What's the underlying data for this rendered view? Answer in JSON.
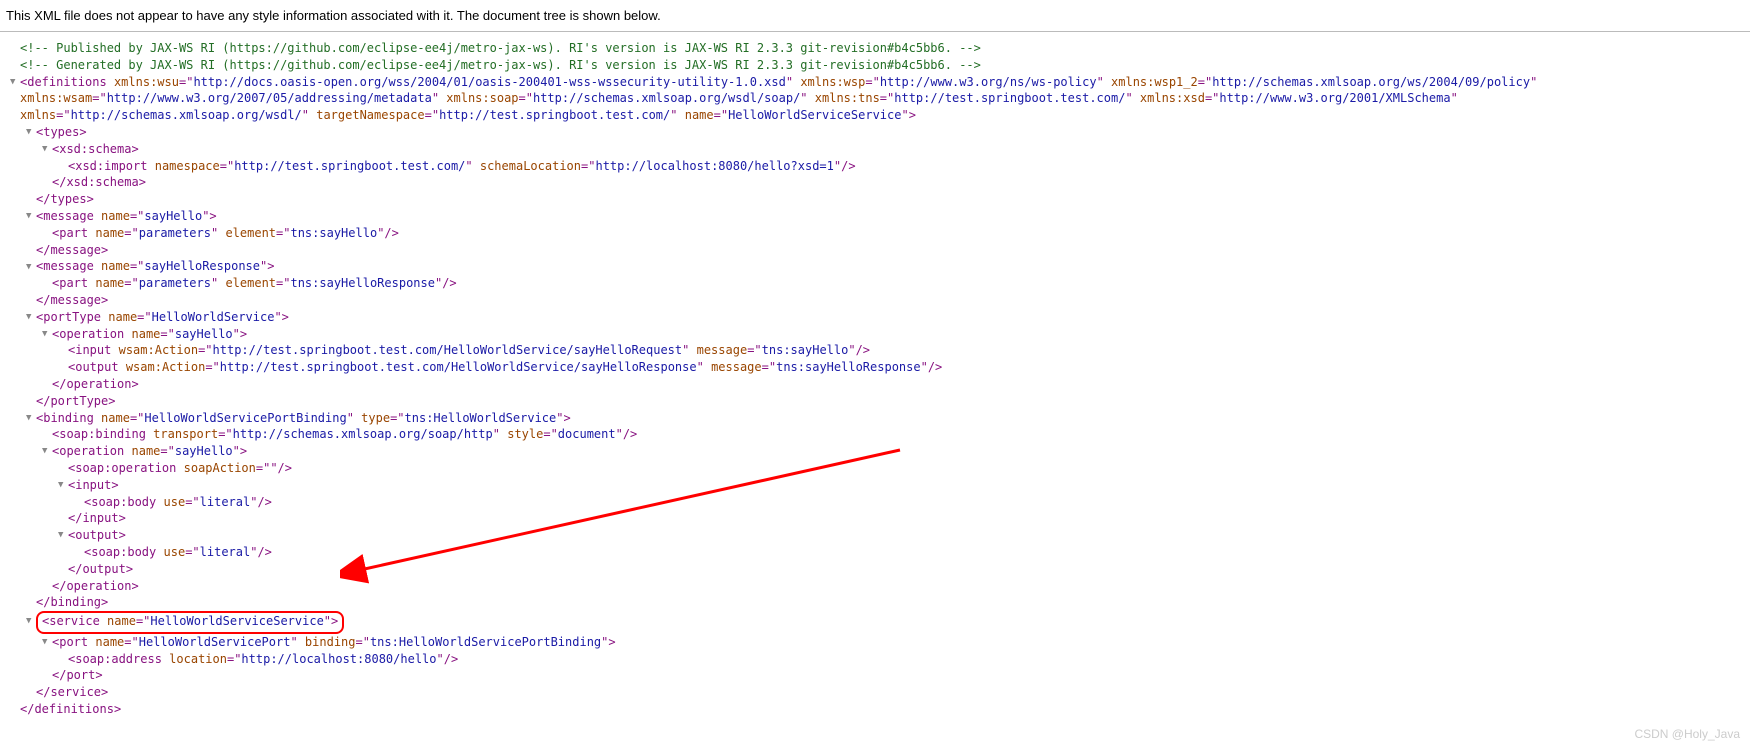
{
  "header": {
    "notice": "This XML file does not appear to have any style information associated with it. The document tree is shown below."
  },
  "comments": {
    "c1": "<!--  Published by JAX-WS RI (https://github.com/eclipse-ee4j/metro-jax-ws). RI's version is JAX-WS RI 2.3.3 git-revision#b4c5bb6.  -->",
    "c2": "<!--  Generated by JAX-WS RI (https://github.com/eclipse-ee4j/metro-jax-ws). RI's version is JAX-WS RI 2.3.3 git-revision#b4c5bb6.  -->"
  },
  "definitions": {
    "tag": "definitions",
    "attrs": {
      "xmlns_wsu": {
        "name": "xmlns:wsu",
        "value": "http://docs.oasis-open.org/wss/2004/01/oasis-200401-wss-wssecurity-utility-1.0.xsd"
      },
      "xmlns_wsp": {
        "name": "xmlns:wsp",
        "value": "http://www.w3.org/ns/ws-policy"
      },
      "xmlns_wsp1_2": {
        "name": "xmlns:wsp1_2",
        "value": "http://schemas.xmlsoap.org/ws/2004/09/policy"
      },
      "xmlns_wsam": {
        "name": "xmlns:wsam",
        "value": "http://www.w3.org/2007/05/addressing/metadata"
      },
      "xmlns_soap": {
        "name": "xmlns:soap",
        "value": "http://schemas.xmlsoap.org/wsdl/soap/"
      },
      "xmlns_tns": {
        "name": "xmlns:tns",
        "value": "http://test.springboot.test.com/"
      },
      "xmlns_xsd": {
        "name": "xmlns:xsd",
        "value": "http://www.w3.org/2001/XMLSchema"
      },
      "xmlns": {
        "name": "xmlns",
        "value": "http://schemas.xmlsoap.org/wsdl/"
      },
      "targetNamespace": {
        "name": "targetNamespace",
        "value": "http://test.springboot.test.com/"
      },
      "name": {
        "name": "name",
        "value": "HelloWorldServiceService"
      }
    }
  },
  "types": {
    "tag": "types",
    "schema_tag": "xsd:schema",
    "import_tag": "xsd:import",
    "import_ns_name": "namespace",
    "import_ns_val": "http://test.springboot.test.com/",
    "import_loc_name": "schemaLocation",
    "import_loc_val": "http://localhost:8080/hello?xsd=1"
  },
  "msg1": {
    "tag": "message",
    "name_attr": "name",
    "name_val": "sayHello",
    "part_tag": "part",
    "part_name_attr": "name",
    "part_name_val": "parameters",
    "part_el_attr": "element",
    "part_el_val": "tns:sayHello"
  },
  "msg2": {
    "tag": "message",
    "name_attr": "name",
    "name_val": "sayHelloResponse",
    "part_tag": "part",
    "part_name_attr": "name",
    "part_name_val": "parameters",
    "part_el_attr": "element",
    "part_el_val": "tns:sayHelloResponse"
  },
  "portType": {
    "tag": "portType",
    "name_attr": "name",
    "name_val": "HelloWorldService",
    "op_tag": "operation",
    "op_name_attr": "name",
    "op_name_val": "sayHello",
    "input_tag": "input",
    "input_action_attr": "wsam:Action",
    "input_action_val": "http://test.springboot.test.com/HelloWorldService/sayHelloRequest",
    "input_msg_attr": "message",
    "input_msg_val": "tns:sayHello",
    "output_tag": "output",
    "output_action_attr": "wsam:Action",
    "output_action_val": "http://test.springboot.test.com/HelloWorldService/sayHelloResponse",
    "output_msg_attr": "message",
    "output_msg_val": "tns:sayHelloResponse"
  },
  "binding": {
    "tag": "binding",
    "name_attr": "name",
    "name_val": "HelloWorldServicePortBinding",
    "type_attr": "type",
    "type_val": "tns:HelloWorldService",
    "sb_tag": "soap:binding",
    "sb_transport_attr": "transport",
    "sb_transport_val": "http://schemas.xmlsoap.org/soap/http",
    "sb_style_attr": "style",
    "sb_style_val": "document",
    "op_tag": "operation",
    "op_name_attr": "name",
    "op_name_val": "sayHello",
    "sop_tag": "soap:operation",
    "sop_action_attr": "soapAction",
    "sop_action_val": "",
    "input_tag": "input",
    "output_tag": "output",
    "body_tag": "soap:body",
    "body_use_attr": "use",
    "body_use_val": "literal"
  },
  "service": {
    "tag": "service",
    "name_attr": "name",
    "name_val": "HelloWorldServiceService",
    "port_tag": "port",
    "port_name_attr": "name",
    "port_name_val": "HelloWorldServicePort",
    "port_binding_attr": "binding",
    "port_binding_val": "tns:HelloWorldServicePortBinding",
    "addr_tag": "soap:address",
    "addr_loc_attr": "location",
    "addr_loc_val": "http://localhost:8080/hello"
  },
  "watermark": "CSDN @Holy_Java"
}
